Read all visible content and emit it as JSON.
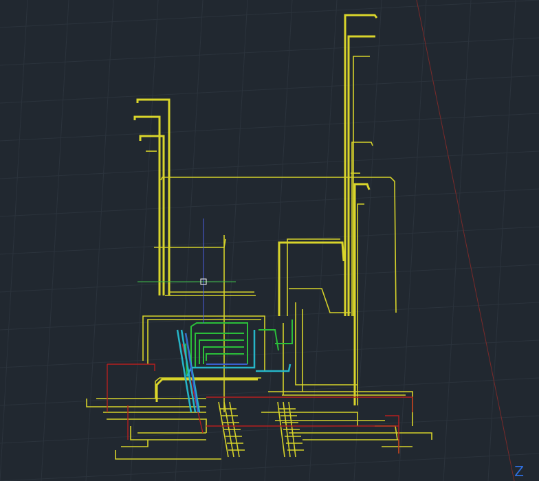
{
  "app": {
    "view": "3D model space",
    "background": "#212830"
  },
  "colors": {
    "yellow_pipe": "#d6d22a",
    "red_pipe": "#b51f1f",
    "green_pipe": "#2bbf3a",
    "cyan_pipe": "#26b6c9",
    "blue_pipe": "#3a5fd0",
    "crosshair_green": "#3fbf4a",
    "crosshair_blue": "#4a5ee0",
    "axis_red": "#7a2a2a"
  },
  "ucs": {
    "axis_label": "Z"
  },
  "cursor": {
    "icon": "crosshair-icon"
  }
}
